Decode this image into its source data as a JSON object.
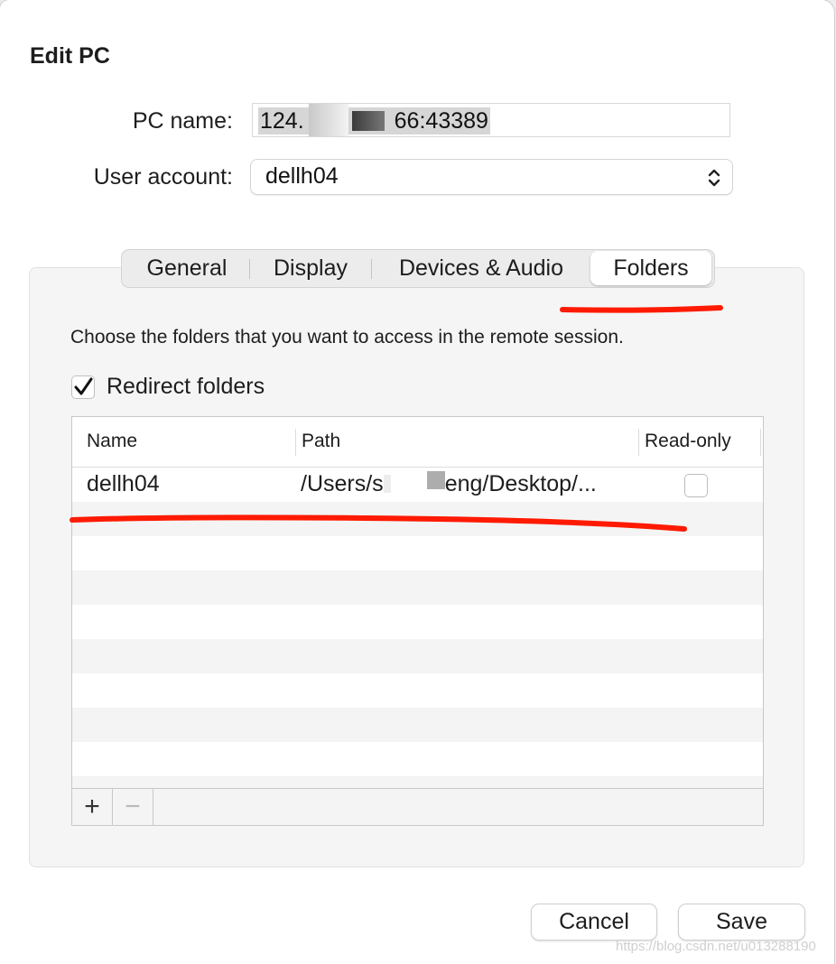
{
  "dialog": {
    "title": "Edit PC"
  },
  "form": {
    "pc_name_label": "PC name:",
    "pc_name_value": "124.    66:43389",
    "user_account_label": "User account:",
    "user_account_value": "dellh04"
  },
  "tabs": [
    {
      "label": "General"
    },
    {
      "label": "Display"
    },
    {
      "label": "Devices & Audio"
    },
    {
      "label": "Folders",
      "selected": true
    }
  ],
  "folders": {
    "description": "Choose the folders that you want to access in the remote session.",
    "redirect_label": "Redirect folders",
    "redirect_checked": true,
    "columns": [
      "Name",
      "Path",
      "Read-only"
    ],
    "rows": [
      {
        "name": "dellh04",
        "path_start": "/Users/s",
        "path_end": "eng/Desktop/...",
        "read_only": false
      }
    ],
    "add_label": "+",
    "remove_label": "−"
  },
  "buttons": {
    "cancel": "Cancel",
    "save": "Save"
  },
  "colors": {
    "annotation_red": "#ff1a00",
    "panel_bg": "#f5f5f5",
    "selection_grey": "#d6d6d6"
  },
  "watermark": "https://blog.csdn.net/u013288190"
}
